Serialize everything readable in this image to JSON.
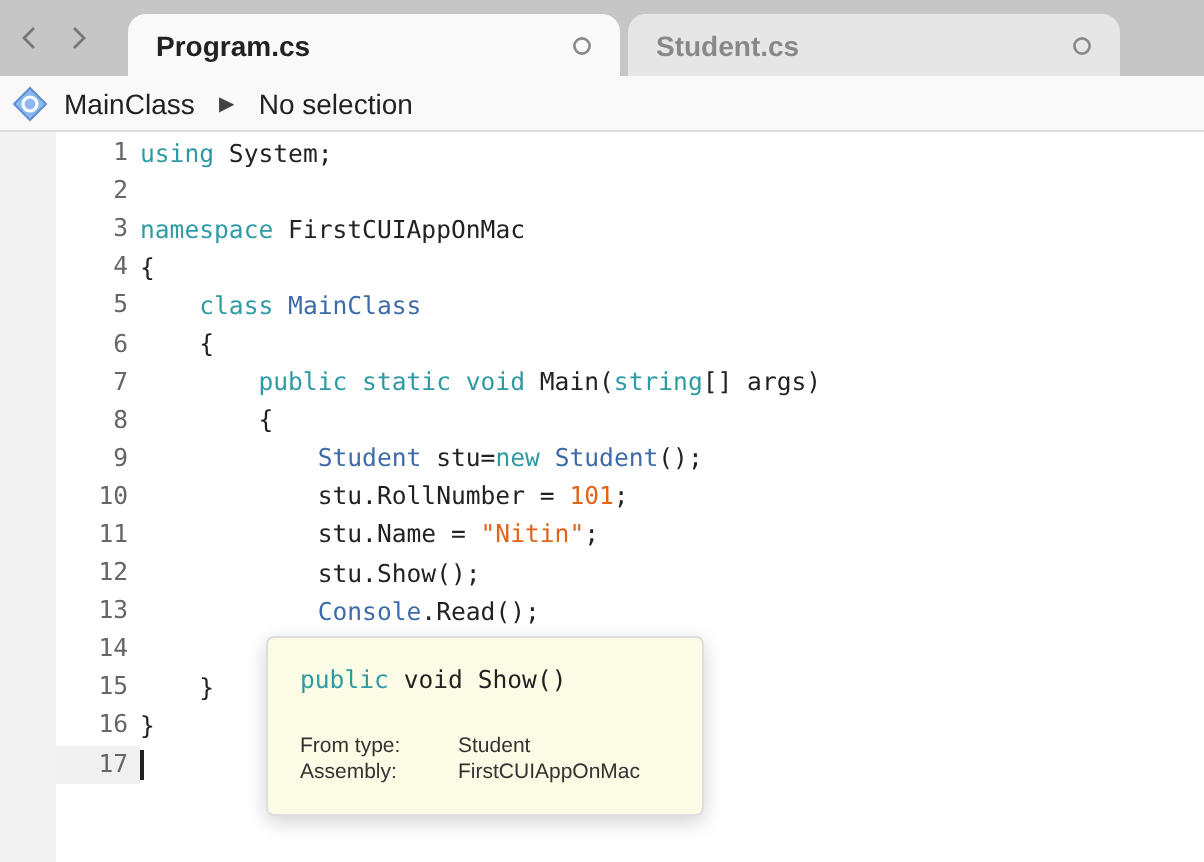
{
  "tabs": [
    {
      "label": "Program.cs",
      "selected": true
    },
    {
      "label": "Student.cs",
      "selected": false
    }
  ],
  "breadcrumb": {
    "class_name": "MainClass",
    "separator": "▶",
    "selection": "No selection"
  },
  "editor": {
    "lines": [
      {
        "number": "1",
        "current": false,
        "tokens": [
          {
            "kind": "keyword",
            "text": "using"
          },
          {
            "kind": "plain",
            "text": " System;"
          }
        ]
      },
      {
        "number": "2",
        "current": false
      },
      {
        "number": "3",
        "current": false,
        "tokens": [
          {
            "kind": "keyword",
            "text": "namespace"
          },
          {
            "kind": "plain",
            "text": " FirstCUIAppOnMac"
          }
        ]
      },
      {
        "number": "4",
        "current": false,
        "tokens": [
          {
            "kind": "plain",
            "text": "{"
          }
        ]
      },
      {
        "number": "5",
        "current": false,
        "tokens": [
          {
            "kind": "keyword",
            "text": "    class"
          },
          {
            "kind": "type",
            "text": " MainClass"
          }
        ]
      },
      {
        "number": "6",
        "current": false,
        "tokens": [
          {
            "kind": "plain",
            "text": "    {"
          }
        ]
      },
      {
        "number": "7",
        "current": false,
        "tokens": [
          {
            "kind": "keyword",
            "text": "        public static void"
          },
          {
            "kind": "plain",
            "text": " Main("
          },
          {
            "kind": "keyword",
            "text": "string"
          },
          {
            "kind": "plain",
            "text": "[] args)"
          }
        ]
      },
      {
        "number": "8",
        "current": false,
        "tokens": [
          {
            "kind": "plain",
            "text": "        {"
          }
        ]
      },
      {
        "number": "9",
        "current": false,
        "tokens": [
          {
            "kind": "type",
            "text": "            Student"
          },
          {
            "kind": "plain",
            "text": " stu="
          },
          {
            "kind": "keyword",
            "text": "new"
          },
          {
            "kind": "type",
            "text": " Student"
          },
          {
            "kind": "plain",
            "text": "();"
          }
        ]
      },
      {
        "number": "10",
        "current": false,
        "tokens": [
          {
            "kind": "plain",
            "text": "            stu.RollNumber = "
          },
          {
            "kind": "number",
            "text": "101"
          },
          {
            "kind": "plain",
            "text": ";"
          }
        ]
      },
      {
        "number": "11",
        "current": false,
        "tokens": [
          {
            "kind": "plain",
            "text": "            stu.Name = "
          },
          {
            "kind": "string",
            "text": "\"Nitin\""
          },
          {
            "kind": "plain",
            "text": ";"
          }
        ]
      },
      {
        "number": "12",
        "current": false,
        "tokens": [
          {
            "kind": "plain",
            "text": "            stu.Show();"
          }
        ]
      },
      {
        "number": "13",
        "current": false,
        "tokens": [
          {
            "kind": "type",
            "text": "            Console"
          },
          {
            "kind": "plain",
            "text": ".Read();"
          }
        ]
      },
      {
        "number": "14",
        "current": false
      },
      {
        "number": "15",
        "current": false,
        "tokens": [
          {
            "kind": "plain",
            "text": "    }"
          }
        ]
      },
      {
        "number": "16",
        "current": false,
        "tokens": [
          {
            "kind": "plain",
            "text": "}"
          }
        ]
      },
      {
        "number": "17",
        "current": true
      }
    ]
  },
  "tooltip": {
    "signature": [
      {
        "kind": "keyword",
        "text": "public"
      },
      {
        "kind": "plain",
        "text": " void Show()"
      }
    ],
    "details": [
      {
        "label": "From type:",
        "value": "Student"
      },
      {
        "label": "Assembly:",
        "value": "FirstCUIAppOnMac"
      }
    ]
  }
}
